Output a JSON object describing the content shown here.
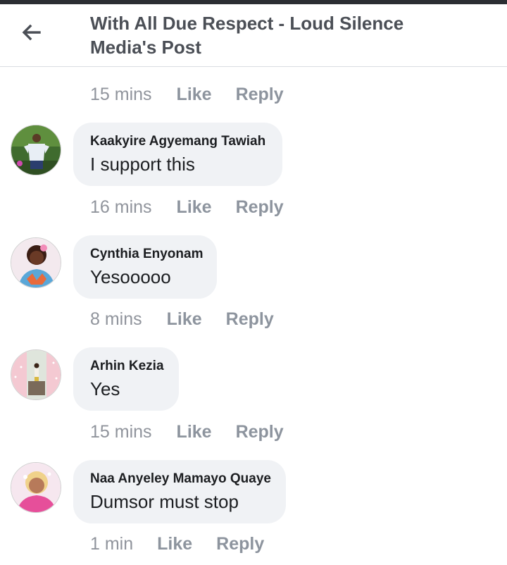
{
  "header": {
    "title": "With All Due Respect - Loud Silence Media's Post",
    "back_icon": "arrow-left-icon"
  },
  "top_meta": {
    "time": "15 mins",
    "like_label": "Like",
    "reply_label": "Reply"
  },
  "comments": [
    {
      "author": "Kaakyire Agyemang Tawiah",
      "text": "I support this",
      "time": "16 mins",
      "like_label": "Like",
      "reply_label": "Reply"
    },
    {
      "author": "Cynthia Enyonam",
      "text": "Yesooooo",
      "time": "8 mins",
      "like_label": "Like",
      "reply_label": "Reply"
    },
    {
      "author": "Arhin Kezia",
      "text": "Yes",
      "time": "15 mins",
      "like_label": "Like",
      "reply_label": "Reply"
    },
    {
      "author": "Naa Anyeley Mamayo Quaye",
      "text": "Dumsor must stop",
      "time": "1 min",
      "like_label": "Like",
      "reply_label": "Reply"
    }
  ],
  "colors": {
    "bubble": "#f0f2f5",
    "meta_text": "#90949c",
    "title_text": "#4b4f56"
  }
}
